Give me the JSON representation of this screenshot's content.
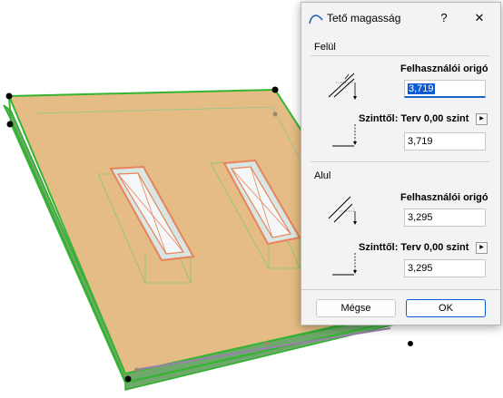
{
  "dialog": {
    "title": "Tető magasság",
    "help_label": "?",
    "close_label": "✕",
    "top_section": {
      "label": "Felül",
      "origin_label": "Felhasználói origó",
      "origin_value": "3,719",
      "reference_label": "Szinttől: Terv 0,00 szint",
      "reference_value": "3,719"
    },
    "bottom_section": {
      "label": "Alul",
      "origin_label": "Felhasználói origó",
      "origin_value": "3,295",
      "reference_label": "Szinttől: Terv 0,00 szint",
      "reference_value": "3,295"
    },
    "cancel_label": "Mégse",
    "ok_label": "OK"
  },
  "colors": {
    "roof_fill": "#e5bc85",
    "roof_edge": "#3cb83a",
    "window_frame": "#e9825b",
    "accent": "#0a5bd3"
  }
}
